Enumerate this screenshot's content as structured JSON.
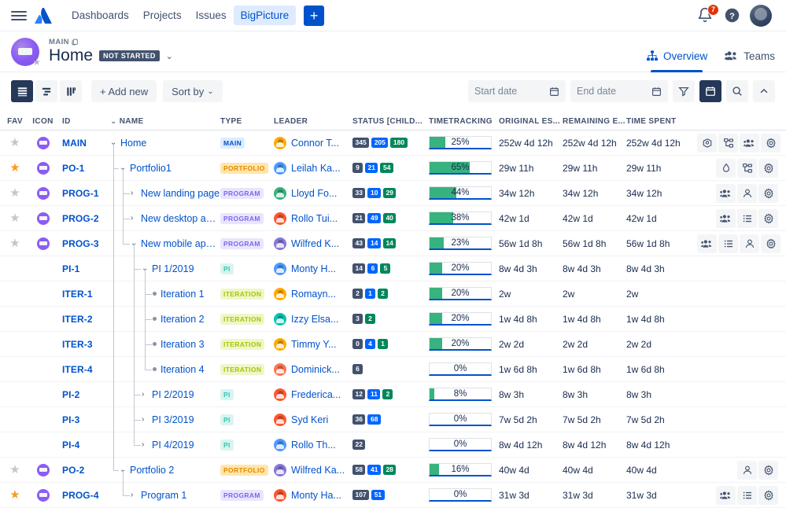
{
  "topnav": {
    "menu_icon": "hamburger-icon",
    "logo_icon": "atlassian-logo-icon",
    "links": [
      {
        "label": "Dashboards",
        "active": false
      },
      {
        "label": "Projects",
        "active": false
      },
      {
        "label": "Issues",
        "active": false
      },
      {
        "label": "BigPicture",
        "active": true
      }
    ],
    "create_label": "+",
    "notification_count": "7",
    "help_label": "?"
  },
  "header": {
    "breadcrumb": "MAIN",
    "title": "Home",
    "status": "NOT STARTED",
    "tabs": [
      {
        "label": "Overview",
        "icon": "hierarchy-icon",
        "active": true
      },
      {
        "label": "Teams",
        "icon": "people-icon",
        "active": false
      }
    ]
  },
  "toolbar": {
    "views": [
      {
        "name": "list-view",
        "active": true
      },
      {
        "name": "gantt-view",
        "active": false
      },
      {
        "name": "board-view",
        "active": false
      }
    ],
    "add_new_label": "+ Add new",
    "sort_by_label": "Sort by",
    "start_date_placeholder": "Start date",
    "end_date_placeholder": "End date",
    "start_date_value": "",
    "end_date_value": "",
    "filter_icon": "filter-icon",
    "calendar_icon": "calendar-icon",
    "search_icon": "search-icon",
    "collapse_icon": "chevron-up-icon"
  },
  "table": {
    "columns": [
      "FAV",
      "ICON",
      "ID",
      "NAME",
      "TYPE",
      "LEADER",
      "STATUS [CHILD...",
      "TIMETRACKING",
      "ORIGINAL ES...",
      "REMAINING E...",
      "TIME SPENT"
    ],
    "name_sort_icon": "chevron-down-icon",
    "rows": [
      {
        "fav": false,
        "has_fav": true,
        "has_icon": true,
        "id": "MAIN",
        "name": "Home",
        "depth": 0,
        "twisty": "down",
        "type": "MAIN",
        "leader": "Connor T...",
        "avatar_color": "#FFAB00",
        "status": [
          {
            "v": "345",
            "k": "todo"
          },
          {
            "v": "205",
            "k": "prog"
          },
          {
            "v": "180",
            "k": "done"
          }
        ],
        "progress": 25,
        "progress_label": "25%",
        "bar_underline": 100,
        "original": "252w 4d 12h",
        "remaining": "252w 4d 12h",
        "spent": "252w 4d 12h",
        "actions": [
          "box-icon",
          "hierarchy-icon",
          "people-icon",
          "gear-icon"
        ]
      },
      {
        "fav": true,
        "has_fav": true,
        "has_icon": true,
        "id": "PO-1",
        "name": "Portfolio1",
        "depth": 1,
        "twisty": "down",
        "type": "PORTFOLIO",
        "leader": "Leilah Ka...",
        "avatar_color": "#4C9AFF",
        "status": [
          {
            "v": "9",
            "k": "todo"
          },
          {
            "v": "21",
            "k": "prog"
          },
          {
            "v": "54",
            "k": "done"
          }
        ],
        "progress": 65,
        "progress_label": "65%",
        "bar_underline": 100,
        "original": "29w 11h",
        "remaining": "29w 11h",
        "spent": "29w 11h",
        "actions": [
          "drop-icon",
          "hierarchy-icon",
          "gear-icon"
        ]
      },
      {
        "fav": false,
        "has_fav": true,
        "has_icon": true,
        "id": "PROG-1",
        "name": "New landing page",
        "depth": 2,
        "twisty": "right",
        "type": "PROGRAM",
        "leader": "Lloyd Fo...",
        "avatar_color": "#36B37E",
        "status": [
          {
            "v": "33",
            "k": "todo"
          },
          {
            "v": "10",
            "k": "prog"
          },
          {
            "v": "29",
            "k": "done"
          }
        ],
        "progress": 44,
        "progress_label": "44%",
        "bar_underline": 97,
        "original": "34w 12h",
        "remaining": "34w 12h",
        "spent": "34w 12h",
        "actions": [
          "people-icon",
          "person-icon",
          "gear-icon"
        ]
      },
      {
        "fav": false,
        "has_fav": true,
        "has_icon": true,
        "id": "PROG-2",
        "name": "New desktop appli...",
        "depth": 2,
        "twisty": "right",
        "type": "PROGRAM",
        "leader": "Rollo Tui...",
        "avatar_color": "#FF5630",
        "status": [
          {
            "v": "21",
            "k": "todo"
          },
          {
            "v": "49",
            "k": "prog"
          },
          {
            "v": "40",
            "k": "done"
          }
        ],
        "progress": 38,
        "progress_label": "38%",
        "bar_underline": 100,
        "original": "42w 1d",
        "remaining": "42w 1d",
        "spent": "42w 1d",
        "actions": [
          "people-icon",
          "list-icon",
          "gear-icon"
        ]
      },
      {
        "fav": false,
        "has_fav": true,
        "has_icon": true,
        "id": "PROG-3",
        "name": "New mobile applic...",
        "depth": 2,
        "twisty": "down",
        "type": "PROGRAM",
        "leader": "Wilfred K...",
        "avatar_color": "#8777D9",
        "status": [
          {
            "v": "43",
            "k": "todo"
          },
          {
            "v": "14",
            "k": "prog"
          },
          {
            "v": "14",
            "k": "done"
          }
        ],
        "progress": 23,
        "progress_label": "23%",
        "bar_underline": 62,
        "original": "56w 1d 8h",
        "remaining": "56w 1d 8h",
        "spent": "56w 1d 8h",
        "actions": [
          "people-icon",
          "list-icon",
          "person-icon",
          "gear-icon"
        ]
      },
      {
        "fav": null,
        "has_fav": false,
        "has_icon": false,
        "id": "PI-1",
        "name": "PI 1/2019",
        "depth": 3,
        "twisty": "down",
        "type": "PI",
        "leader": "Monty H...",
        "avatar_color": "#4C9AFF",
        "status": [
          {
            "v": "14",
            "k": "todo"
          },
          {
            "v": "6",
            "k": "prog"
          },
          {
            "v": "5",
            "k": "done"
          }
        ],
        "progress": 20,
        "progress_label": "20%",
        "bar_underline": 100,
        "original": "8w 4d 3h",
        "remaining": "8w 4d 3h",
        "spent": "8w 4d 3h",
        "actions": []
      },
      {
        "fav": null,
        "has_fav": false,
        "has_icon": false,
        "id": "ITER-1",
        "name": "Iteration 1",
        "depth": 4,
        "twisty": "leaf",
        "type": "ITERATION",
        "leader": "Romayn...",
        "avatar_color": "#FFAB00",
        "status": [
          {
            "v": "2",
            "k": "todo"
          },
          {
            "v": "1",
            "k": "prog"
          },
          {
            "v": "2",
            "k": "done"
          }
        ],
        "progress": 20,
        "progress_label": "20%",
        "bar_underline": 100,
        "original": "2w",
        "remaining": "2w",
        "spent": "2w",
        "actions": []
      },
      {
        "fav": null,
        "has_fav": false,
        "has_icon": false,
        "id": "ITER-2",
        "name": "Iteration 2",
        "depth": 4,
        "twisty": "leaf",
        "type": "ITERATION",
        "leader": "Izzy Elsa...",
        "avatar_color": "#00C7B7",
        "status": [
          {
            "v": "3",
            "k": "todo"
          },
          {
            "v": "2",
            "k": "done"
          }
        ],
        "progress": 20,
        "progress_label": "20%",
        "bar_underline": 100,
        "original": "1w 4d 8h",
        "remaining": "1w 4d 8h",
        "spent": "1w 4d 8h",
        "actions": []
      },
      {
        "fav": null,
        "has_fav": false,
        "has_icon": false,
        "id": "ITER-3",
        "name": "Iteration 3",
        "depth": 4,
        "twisty": "leaf",
        "type": "ITERATION",
        "leader": "Timmy Y...",
        "avatar_color": "#FFAB00",
        "status": [
          {
            "v": "0",
            "k": "todo"
          },
          {
            "v": "4",
            "k": "prog"
          },
          {
            "v": "1",
            "k": "done"
          }
        ],
        "progress": 20,
        "progress_label": "20%",
        "bar_underline": 100,
        "original": "2w 2d",
        "remaining": "2w 2d",
        "spent": "2w 2d",
        "actions": []
      },
      {
        "fav": null,
        "has_fav": false,
        "has_icon": false,
        "id": "ITER-4",
        "name": "Iteration 4",
        "depth": 4,
        "twisty": "leaf",
        "type": "ITERATION",
        "leader": "Dominick...",
        "avatar_color": "#FF7452",
        "status": [
          {
            "v": "6",
            "k": "todo"
          }
        ],
        "progress": 0,
        "progress_label": "0%",
        "bar_underline": 100,
        "original": "1w 6d 8h",
        "remaining": "1w 6d 8h",
        "spent": "1w 6d 8h",
        "actions": []
      },
      {
        "fav": null,
        "has_fav": false,
        "has_icon": false,
        "id": "PI-2",
        "name": "PI 2/2019",
        "depth": 3,
        "twisty": "right",
        "type": "PI",
        "leader": "Frederica...",
        "avatar_color": "#FF5630",
        "status": [
          {
            "v": "12",
            "k": "todo"
          },
          {
            "v": "11",
            "k": "prog"
          },
          {
            "v": "2",
            "k": "done"
          }
        ],
        "progress": 8,
        "progress_label": "8%",
        "bar_underline": 100,
        "original": "8w 3h",
        "remaining": "8w 3h",
        "spent": "8w 3h",
        "actions": []
      },
      {
        "fav": null,
        "has_fav": false,
        "has_icon": false,
        "id": "PI-3",
        "name": "PI 3/2019",
        "depth": 3,
        "twisty": "right",
        "type": "PI",
        "leader": "Syd Keri",
        "avatar_color": "#FF5630",
        "status": [
          {
            "v": "36",
            "k": "todo"
          },
          {
            "v": "68",
            "k": "prog"
          }
        ],
        "progress": 0,
        "progress_label": "0%",
        "bar_underline": 100,
        "original": "7w 5d 2h",
        "remaining": "7w 5d 2h",
        "spent": "7w 5d 2h",
        "actions": []
      },
      {
        "fav": null,
        "has_fav": false,
        "has_icon": false,
        "id": "PI-4",
        "name": "PI 4/2019",
        "depth": 3,
        "twisty": "right",
        "type": "PI",
        "leader": "Rollo Th...",
        "avatar_color": "#4C9AFF",
        "status": [
          {
            "v": "22",
            "k": "todo"
          }
        ],
        "progress": 0,
        "progress_label": "0%",
        "bar_underline": 100,
        "original": "8w 4d 12h",
        "remaining": "8w 4d 12h",
        "spent": "8w 4d 12h",
        "actions": []
      },
      {
        "fav": false,
        "has_fav": true,
        "has_icon": true,
        "id": "PO-2",
        "name": "Portfolio 2",
        "depth": 1,
        "twisty": "down",
        "type": "PORTFOLIO",
        "leader": "Wilfred Ka...",
        "avatar_color": "#8777D9",
        "status": [
          {
            "v": "58",
            "k": "todo"
          },
          {
            "v": "41",
            "k": "prog"
          },
          {
            "v": "28",
            "k": "done"
          }
        ],
        "progress": 16,
        "progress_label": "16%",
        "bar_underline": 100,
        "original": "40w 4d",
        "remaining": "40w 4d",
        "spent": "40w 4d",
        "actions": [
          "person-icon",
          "gear-icon"
        ]
      },
      {
        "fav": true,
        "has_fav": true,
        "has_icon": true,
        "id": "PROG-4",
        "name": "Program 1",
        "depth": 2,
        "twisty": "right",
        "type": "PROGRAM",
        "leader": "Monty Ha...",
        "avatar_color": "#FF5630",
        "status": [
          {
            "v": "107",
            "k": "todo"
          },
          {
            "v": "51",
            "k": "prog"
          }
        ],
        "progress": 0,
        "progress_label": "0%",
        "bar_underline": 100,
        "original": "31w 3d",
        "remaining": "31w 3d",
        "spent": "31w 3d",
        "actions": [
          "people-icon",
          "list-icon",
          "gear-icon"
        ]
      }
    ]
  },
  "colors": {
    "brand_blue": "#0052CC",
    "link_blue": "#0052CC",
    "green": "#36B37E",
    "navy": "#253858",
    "warn_orange": "#FF991F",
    "danger_red": "#DE350B"
  }
}
